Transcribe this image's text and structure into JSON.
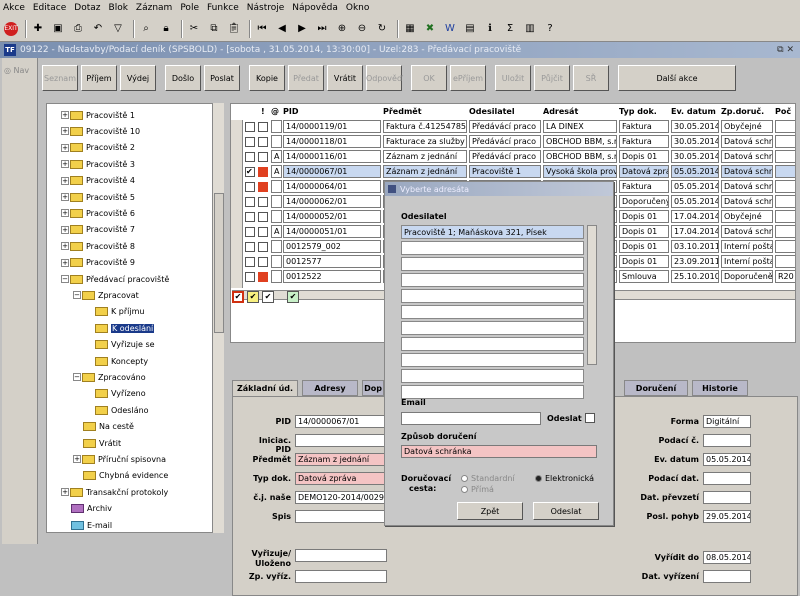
{
  "menu": [
    "Akce",
    "Editace",
    "Dotaz",
    "Blok",
    "Záznam",
    "Pole",
    "Funkce",
    "Nástroje",
    "Nápověda",
    "Okno"
  ],
  "window_title": "09122 - Nadstavby/Podací deník (SPSBOLD) - [sobota , 31.05.2014, 13:30:00] - Uzel:283 - Předávací pracoviště",
  "window_controls": "⧉ ✕",
  "nav_label": "Nav",
  "action_buttons": [
    {
      "label": "Seznam",
      "disabled": true
    },
    {
      "label": "Příjem",
      "disabled": false
    },
    {
      "label": "Výdej",
      "disabled": false
    },
    {
      "label": "Došlo",
      "disabled": false
    },
    {
      "label": "Poslat",
      "disabled": false
    },
    {
      "label": "Kopie",
      "disabled": false
    },
    {
      "label": "Předat",
      "disabled": true
    },
    {
      "label": "Vrátit",
      "disabled": false
    },
    {
      "label": "Odpověď",
      "disabled": true
    },
    {
      "label": "OK",
      "disabled": true
    },
    {
      "label": "ePříjem",
      "disabled": true
    },
    {
      "label": "Uložit",
      "disabled": true
    },
    {
      "label": "Půjčit",
      "disabled": true
    },
    {
      "label": "SŘ",
      "disabled": true
    },
    {
      "label": "Další akce",
      "disabled": false
    }
  ],
  "tree": [
    {
      "label": "Pracoviště 1",
      "level": 0,
      "exp": "+"
    },
    {
      "label": "Pracoviště 10",
      "level": 0,
      "exp": "+"
    },
    {
      "label": "Pracoviště 2",
      "level": 0,
      "exp": "+"
    },
    {
      "label": "Pracoviště 3",
      "level": 0,
      "exp": "+"
    },
    {
      "label": "Pracoviště 4",
      "level": 0,
      "exp": "+"
    },
    {
      "label": "Pracoviště 5",
      "level": 0,
      "exp": "+"
    },
    {
      "label": "Pracoviště 6",
      "level": 0,
      "exp": "+"
    },
    {
      "label": "Pracoviště 7",
      "level": 0,
      "exp": "+"
    },
    {
      "label": "Pracoviště 8",
      "level": 0,
      "exp": "+"
    },
    {
      "label": "Pracoviště 9",
      "level": 0,
      "exp": "+"
    },
    {
      "label": "Předávací pracoviště",
      "level": 0,
      "exp": "-"
    },
    {
      "label": "Zpracovat",
      "level": 1,
      "exp": "-"
    },
    {
      "label": "K příjmu",
      "level": 2,
      "exp": ""
    },
    {
      "label": "K odeslání",
      "level": 2,
      "exp": "",
      "selected": true
    },
    {
      "label": "Vyřizuje se",
      "level": 2,
      "exp": ""
    },
    {
      "label": "Koncepty",
      "level": 2,
      "exp": ""
    },
    {
      "label": "Zpracováno",
      "level": 1,
      "exp": "-"
    },
    {
      "label": "Vyřízeno",
      "level": 2,
      "exp": ""
    },
    {
      "label": "Odesláno",
      "level": 2,
      "exp": ""
    },
    {
      "label": "Na cestě",
      "level": 1,
      "exp": ""
    },
    {
      "label": "Vrátit",
      "level": 1,
      "exp": ""
    },
    {
      "label": "Příruční spisovna",
      "level": 1,
      "exp": "+"
    },
    {
      "label": "Chybná evidence",
      "level": 1,
      "exp": ""
    },
    {
      "label": "Transakční protokoly",
      "level": 0,
      "exp": "+"
    },
    {
      "label": "Archiv",
      "level": 0,
      "exp": "",
      "color": "purple"
    },
    {
      "label": "E-mail",
      "level": 0,
      "exp": "",
      "color": "cyan"
    }
  ],
  "grid": {
    "headers": {
      "excl": "!",
      "clip": "@",
      "pid": "PID",
      "predmet": "Předmět",
      "odesilatel": "Odesilatel",
      "adresat": "Adresát",
      "typ": "Typ dok.",
      "ev": "Ev. datum",
      "zp": "Zp.doruč.",
      "poc": "Poč"
    },
    "rows": [
      {
        "a": "",
        "pid": "14/0000119/01",
        "predmet": "Faktura č.41254785",
        "odesilatel": "Předávácí praco",
        "adresat": "LA DINEX",
        "typ": "Faktura",
        "ev": "30.05.2014",
        "zp": "Obyčejné",
        "poc": "",
        "checked": false,
        "red": false
      },
      {
        "a": "",
        "pid": "14/0000118/01",
        "predmet": "Fakturace za služby",
        "odesilatel": "Předávácí praco",
        "adresat": "OBCHOD BBM, s.r",
        "typ": "Faktura",
        "ev": "30.05.2014",
        "zp": "Datová schrá",
        "poc": "",
        "checked": false,
        "red": false
      },
      {
        "a": "A",
        "pid": "14/0000116/01",
        "predmet": "Záznam z jednání",
        "odesilatel": "Předávácí praco",
        "adresat": "OBCHOD BBM, s.r",
        "typ": "Dopis 01",
        "ev": "30.05.2014",
        "zp": "Datová schrá",
        "poc": "",
        "checked": false,
        "red": false
      },
      {
        "a": "A",
        "pid": "14/0000067/01",
        "predmet": "Záznam z jednání",
        "odesilatel": "Pracoviště 1",
        "adresat": "Vysoká škola prov",
        "typ": "Datová zpráv",
        "ev": "05.05.2014",
        "zp": "Datová schrá",
        "poc": "",
        "checked": true,
        "red": true,
        "hl": true
      },
      {
        "a": "",
        "pid": "14/0000064/01",
        "predmet": "",
        "odesilatel": "",
        "adresat": "",
        "typ": "Faktura",
        "ev": "05.05.2014",
        "zp": "Datová schrá",
        "poc": "",
        "checked": false,
        "red": true
      },
      {
        "a": "",
        "pid": "14/0000062/01",
        "predmet": "",
        "odesilatel": "",
        "adresat": "",
        "typ": "Doporučený",
        "ev": "05.05.2014",
        "zp": "Datová schrá",
        "poc": "",
        "checked": false,
        "red": false
      },
      {
        "a": "",
        "pid": "14/0000052/01",
        "predmet": "",
        "odesilatel": "",
        "adresat": "",
        "typ": "Dopis 01",
        "ev": "17.04.2014",
        "zp": "Obyčejné",
        "poc": "",
        "checked": false,
        "red": false
      },
      {
        "a": "A",
        "pid": "14/0000051/01",
        "predmet": "",
        "odesilatel": "",
        "adresat": "",
        "typ": "Dopis 01",
        "ev": "17.04.2014",
        "zp": "Datová schrá",
        "poc": "",
        "checked": false,
        "red": false
      },
      {
        "a": "",
        "pid": "0012579_002",
        "predmet": "",
        "odesilatel": "",
        "adresat": "",
        "typ": "Dopis 01",
        "ev": "03.10.2011",
        "zp": "Interní pošta",
        "poc": "",
        "checked": false,
        "red": false
      },
      {
        "a": "",
        "pid": "0012577",
        "predmet": "",
        "odesilatel": "",
        "adresat": "",
        "typ": "Dopis 01",
        "ev": "23.09.2011",
        "zp": "Interní pošta",
        "poc": "",
        "checked": false,
        "red": false
      },
      {
        "a": "",
        "pid": "0012522",
        "predmet": "",
        "odesilatel": "",
        "adresat": "",
        "typ": "Smlouva",
        "ev": "25.10.2010",
        "zp": "Doporučeně",
        "poc": "R20",
        "checked": false,
        "red": true
      }
    ]
  },
  "tabs": [
    "Základní úd.",
    "Adresy",
    "Dop",
    "Doručení",
    "Historie"
  ],
  "form": {
    "pid_label": "PID",
    "pid": "14/0000067/01",
    "iniciac_label": "Iniciac. PID",
    "iniciac": "",
    "predmet_label": "Předmět",
    "predmet": "Záznam z jednání",
    "typ_label": "Typ dok.",
    "typ": "Datová zpráva",
    "cj_label": "č.j. naše",
    "cj": "DEMO120-2014/00296",
    "spis_label": "Spis",
    "spis": "",
    "vyrizuje_label": "Vyřizuje/",
    "ulozeno_label": "Uloženo",
    "zp_label": "Zp. vyříz.",
    "forma_label": "Forma",
    "forma": "Digitální",
    "podaci_c_label": "Podací č.",
    "podaci_c": "",
    "ev_label": "Ev. datum",
    "ev": "05.05.2014",
    "podaci_dat_label": "Podací dat.",
    "podaci_dat": "",
    "prevzeti_label": "Dat. převzetí",
    "prevzeti": "",
    "posl_label": "Posl. pohyb",
    "posl": "29.05.2014",
    "vyridit_label": "Vyřídit do",
    "vyridit": "08.05.2014",
    "vyrizeni_label": "Dat. vyřízení",
    "vyrizeni": ""
  },
  "dialog": {
    "title": "Vyberte adresáta",
    "odesilatel_label": "Odesilatel",
    "odesilatel_items": [
      "Pracoviště 1; Maňáskova 321, Písek",
      "",
      "",
      "",
      "",
      "",
      "",
      "",
      "",
      "",
      ""
    ],
    "email_label": "Email",
    "email": "",
    "odeslat_chk_label": "Odeslat",
    "zpusob_label": "Způsob doručení",
    "zpusob": "Datová schránka",
    "cesta_label1": "Doručovací",
    "cesta_label2": "cesta:",
    "radio_standard": "Standardní",
    "radio_prima": "Přímá",
    "radio_elektro": "Elektronická",
    "zpet": "Zpět",
    "odeslat": "Odeslat"
  }
}
